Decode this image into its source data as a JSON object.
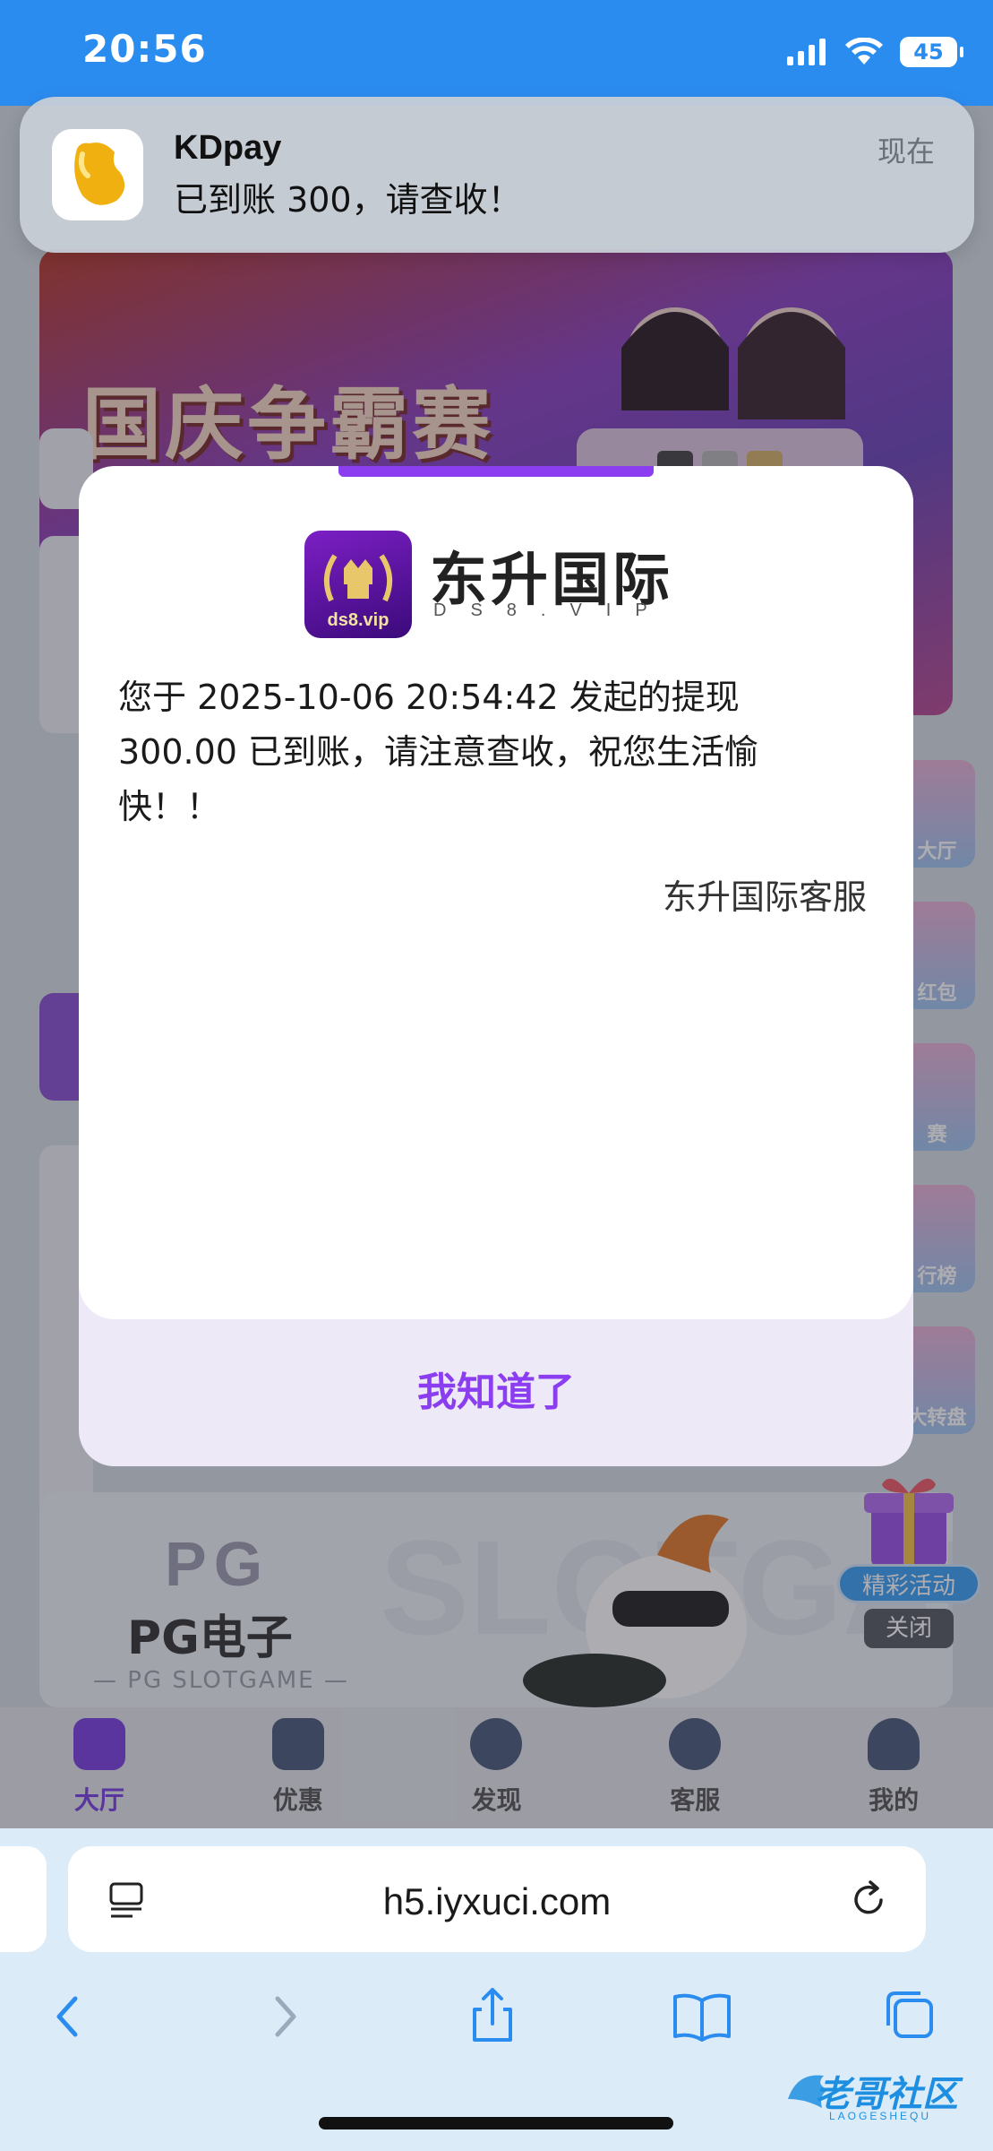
{
  "status_bar": {
    "time": "20:56",
    "battery": "45"
  },
  "notification": {
    "app": "KDpay",
    "message": "已到账 300，请查收！",
    "time": "现在"
  },
  "background": {
    "banner_title": "国庆争霸赛",
    "side_icons": [
      "大厅",
      "红包",
      "赛",
      "行榜",
      "大转盘"
    ],
    "pg_card": {
      "logo": "PG",
      "title": "PG电子",
      "subtitle": "— PG SLOTGAME —",
      "bg_text": "SLOTGAME"
    },
    "float_label": "精彩活动",
    "float_close": "关闭",
    "tabs": [
      {
        "label": "大厅",
        "active": true
      },
      {
        "label": "优惠",
        "active": false
      },
      {
        "label": "发现",
        "active": false
      },
      {
        "label": "客服",
        "active": false
      },
      {
        "label": "我的",
        "active": false
      }
    ]
  },
  "modal": {
    "brand_name": "东升国际",
    "brand_domain": "DS8.VIP",
    "logo_text": "ds8.vip",
    "message": "您于 2025-10-06 20:54:42 发起的提现 300.00 已到账，请注意查收，祝您生活愉快！！",
    "signature": "东升国际客服",
    "button": "我知道了"
  },
  "browser": {
    "url": "h5.iyxuci.com"
  },
  "watermark": {
    "text": "老哥社区",
    "sub": "LAOGESHEQU"
  },
  "colors": {
    "accent": "#8b3ef0",
    "status_bar": "#2b8cf0"
  }
}
